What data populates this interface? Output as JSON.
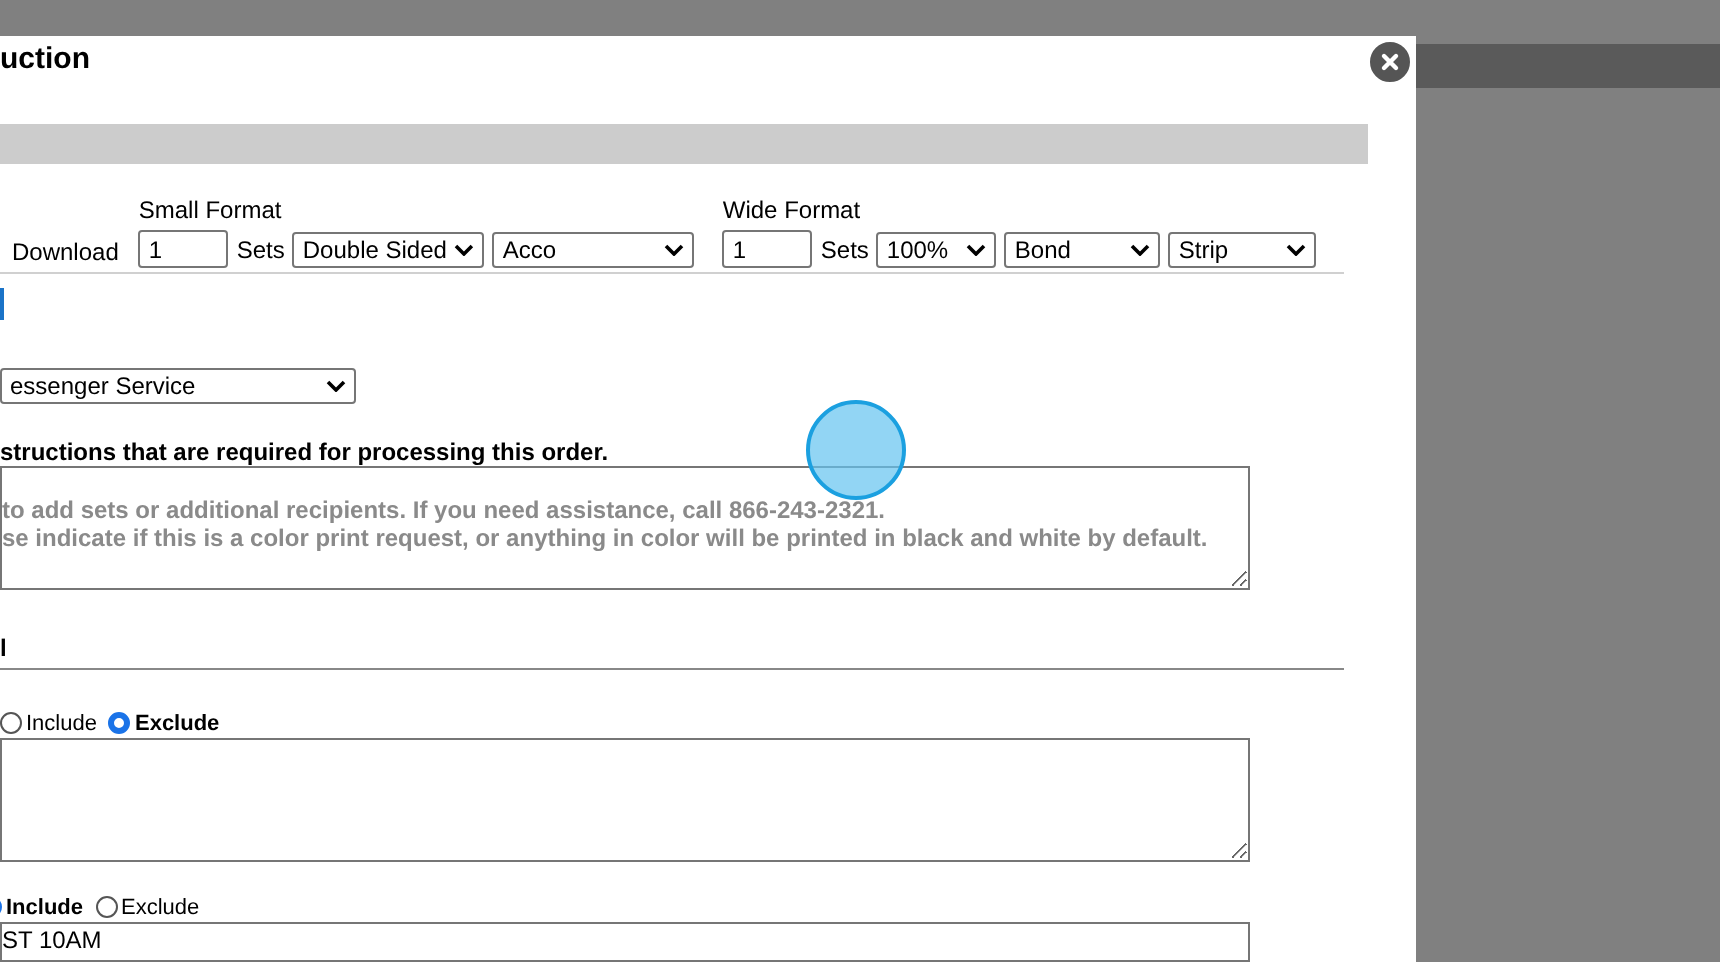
{
  "title": "uction",
  "download": {
    "label": "Download"
  },
  "small_format": {
    "label": "Small Format",
    "sets": "1",
    "sets_label": "Sets",
    "sides": "Double Sided",
    "binding": "Acco"
  },
  "wide_format": {
    "label": "Wide Format",
    "sets": "1",
    "sets_label": "Sets",
    "scale": "100%",
    "paper": "Bond",
    "finish": "Strip"
  },
  "delivery_method": "essenger Service",
  "instructions": {
    "label": "structions that are required for processing this order.",
    "placeholder": "to add sets or additional recipients. If you need assistance, call 866-243-2321.\nse indicate if this is a color print request, or anything in color will be printed in black and white by default."
  },
  "section_heading": "l",
  "option_groups": [
    {
      "options": [
        {
          "label": "Include",
          "selected": false
        },
        {
          "label": "Exclude",
          "selected": true
        }
      ]
    },
    {
      "options": [
        {
          "label": "Include",
          "selected": true
        },
        {
          "label": "Exclude",
          "selected": false
        }
      ],
      "value": "ST 10AM"
    }
  ]
}
